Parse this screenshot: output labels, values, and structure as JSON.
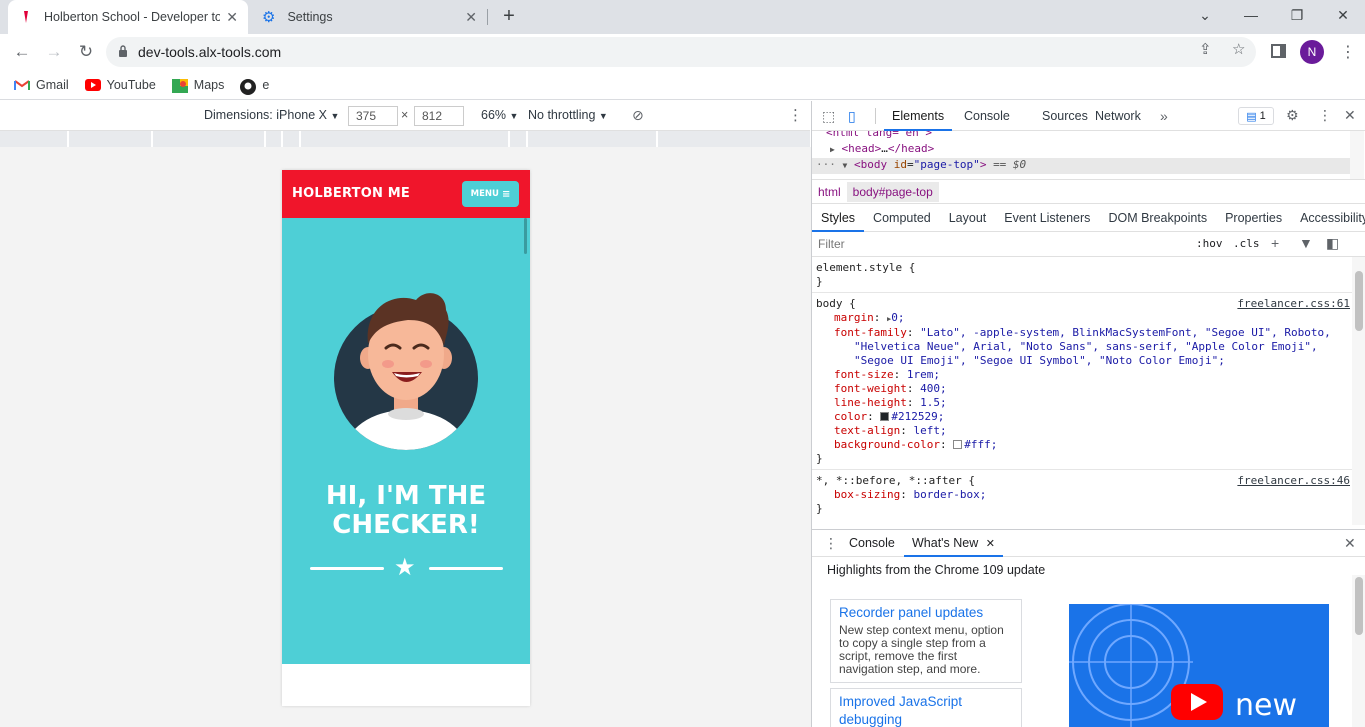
{
  "browser": {
    "tabs": [
      {
        "title": "Holberton School - Developer to",
        "active": true
      },
      {
        "title": "Settings",
        "active": false
      }
    ],
    "url": "dev-tools.alx-tools.com",
    "profile_initial": "N",
    "bookmarks": [
      {
        "label": "Gmail",
        "icon": "gmail-icon"
      },
      {
        "label": "YouTube",
        "icon": "youtube-icon"
      },
      {
        "label": "Maps",
        "icon": "maps-icon"
      },
      {
        "label": "e",
        "icon": "github-icon"
      }
    ]
  },
  "device_toolbar": {
    "dimensions_label": "Dimensions: iPhone X",
    "width": "375",
    "height": "812",
    "times": "×",
    "zoom": "66%",
    "throttling": "No throttling"
  },
  "page": {
    "brand": "HOLBERTON ME",
    "menu_label": "MENU",
    "hero_line1": "HI, I'M THE",
    "hero_line2": "CHECKER!",
    "colors": {
      "nav": "#f0152b",
      "masthead": "#4ecfd6"
    }
  },
  "devtools": {
    "tabs": [
      "Elements",
      "Console",
      "Sources",
      "Network"
    ],
    "issues_count": "1",
    "dom": {
      "line1": "<html lang=\"en\">",
      "head_tag": "<head>",
      "head_ellipsis": "…",
      "head_close": "</head>",
      "body_open": "<body",
      "body_attr": "id",
      "body_attr_val": "\"page-top\"",
      "body_close": ">",
      "eq": "== $0"
    },
    "breadcrumbs": [
      "html",
      "body#page-top"
    ],
    "subtabs": [
      "Styles",
      "Computed",
      "Layout",
      "Event Listeners",
      "DOM Breakpoints",
      "Properties",
      "Accessibility"
    ],
    "filter_placeholder": "Filter",
    "hov": ":hov",
    "cls": ".cls",
    "element_style": "element.style {",
    "close_brace": "}",
    "body_rule": {
      "selector": "body {",
      "source": "freelancer.css:61",
      "props": [
        {
          "name": "margin",
          "value": "0;"
        },
        {
          "name": "font-family",
          "value": "\"Lato\", -apple-system, BlinkMacSystemFont, \"Segoe UI\", Roboto,"
        },
        {
          "name": "",
          "value": "\"Helvetica Neue\", Arial, \"Noto Sans\", sans-serif, \"Apple Color Emoji\","
        },
        {
          "name": "",
          "value": "\"Segoe UI Emoji\", \"Segoe UI Symbol\", \"Noto Color Emoji\";"
        },
        {
          "name": "font-size",
          "value": "1rem;"
        },
        {
          "name": "font-weight",
          "value": "400;"
        },
        {
          "name": "line-height",
          "value": "1.5;"
        },
        {
          "name": "color",
          "value": "#212529;"
        },
        {
          "name": "text-align",
          "value": "left;"
        },
        {
          "name": "background-color",
          "value": "#fff;"
        }
      ]
    },
    "universal_rule": {
      "selector": "*, *::before, *::after {",
      "source": "freelancer.css:46",
      "prop": "box-sizing",
      "value": "border-box;"
    },
    "drawer": {
      "tabs": [
        "Console",
        "What's New"
      ],
      "heading": "Highlights from the Chrome 109 update",
      "cards": [
        {
          "title": "Recorder panel updates",
          "body": "New step context menu, option to copy a single step from a script, remove the first navigation step, and more."
        },
        {
          "title": "Improved JavaScript debugging",
          "body": ""
        }
      ],
      "promo_text": "new"
    }
  }
}
